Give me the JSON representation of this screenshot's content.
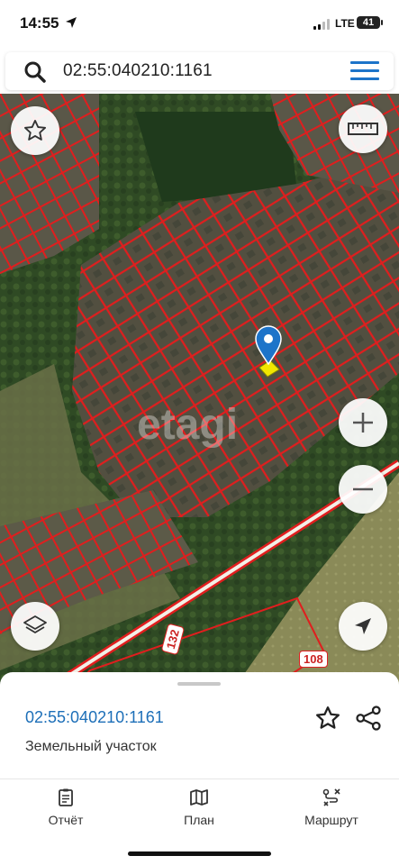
{
  "status_bar": {
    "time": "14:55",
    "network": "LTE",
    "battery": "41"
  },
  "search": {
    "query": "02:55:040210:1161"
  },
  "map": {
    "watermark": "etagi",
    "road_labels": [
      "132",
      "108"
    ],
    "parcel_color": "#e01e1e",
    "marker_color": "#1d74c9",
    "selected_parcel_color": "#f2e600"
  },
  "controls": {
    "favorite": "star-icon",
    "ruler": "ruler-icon",
    "zoom_in": "plus-icon",
    "zoom_out": "minus-icon",
    "layers": "layers-icon",
    "location": "navigation-arrow-icon"
  },
  "sheet": {
    "cadastral_number": "02:55:040210:1161",
    "object_type": "Земельный участок"
  },
  "tabs": [
    {
      "label": "Отчёт",
      "icon": "clipboard-icon"
    },
    {
      "label": "План",
      "icon": "map-icon"
    },
    {
      "label": "Маршрут",
      "icon": "route-icon"
    }
  ],
  "colors": {
    "accent": "#1d74c9",
    "link": "#1d6fb8"
  }
}
